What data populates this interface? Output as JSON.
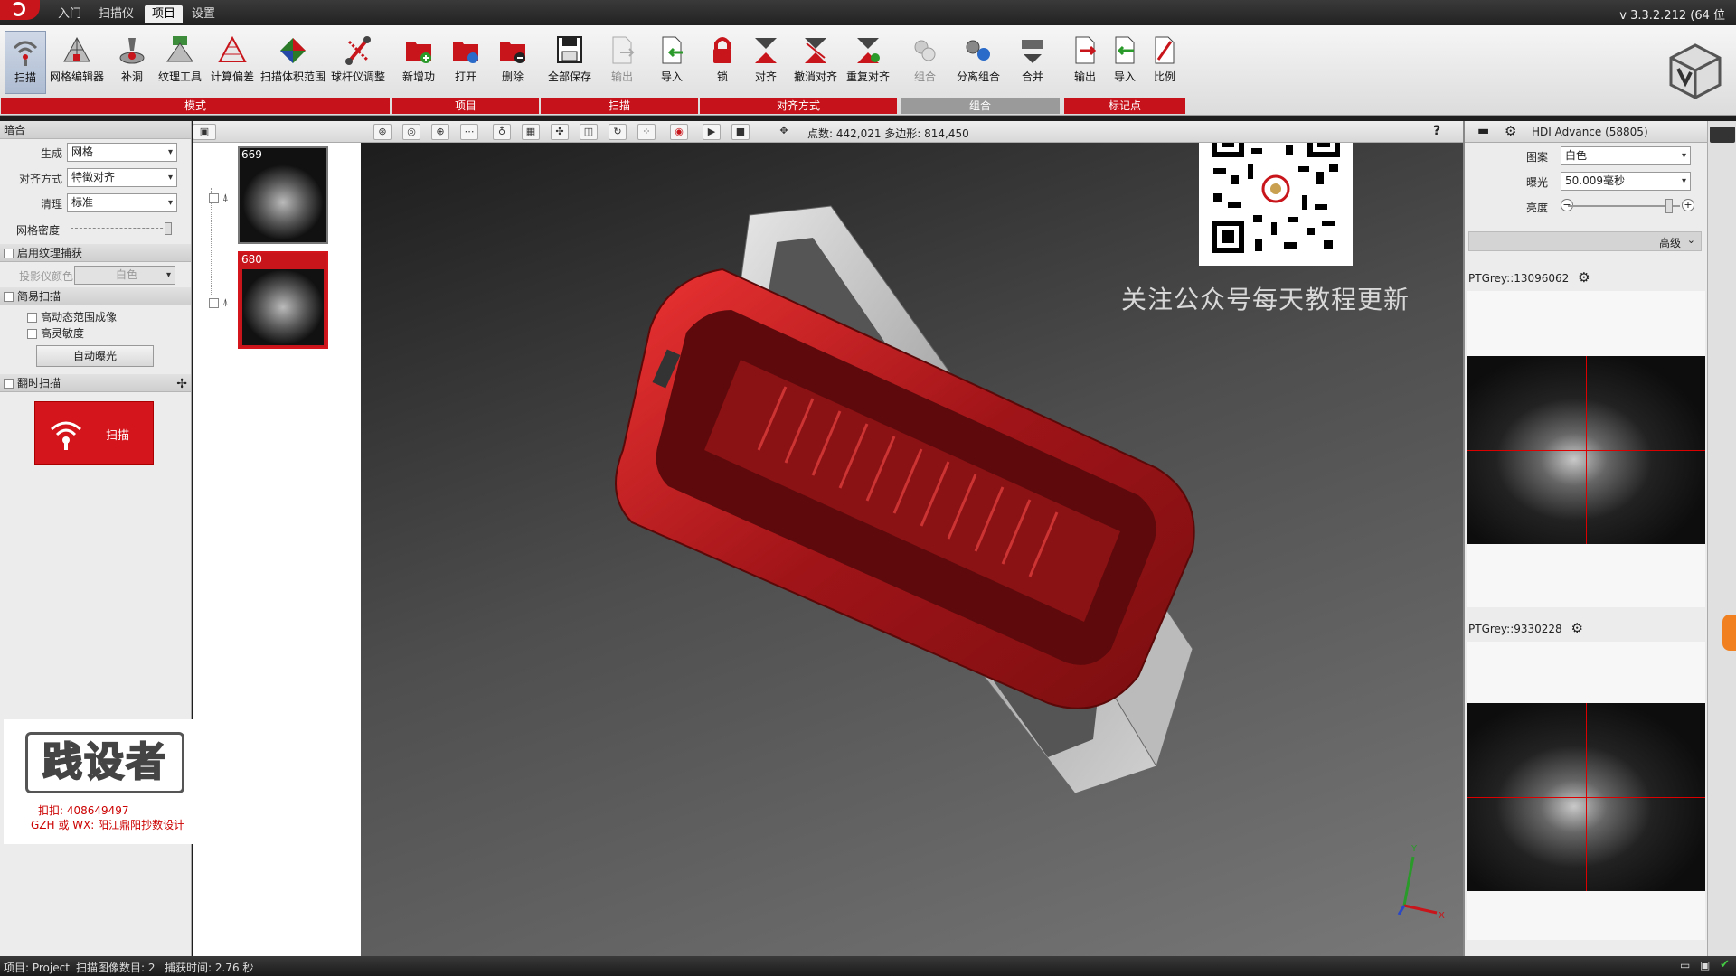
{
  "menubar": {
    "items": [
      "入门",
      "扫描仪",
      "项目",
      "设置"
    ],
    "active": "项目",
    "version": "v 3.3.2.212 (64 位"
  },
  "ribbon": {
    "groups": [
      {
        "label": "模式",
        "buttons": [
          "扫描",
          "网格编辑器",
          "补洞",
          "纹理工具",
          "计算偏差",
          "扫描体积范围",
          "球杆仪调整"
        ]
      },
      {
        "label": "项目",
        "buttons": [
          "新增功",
          "打开",
          "删除"
        ]
      },
      {
        "label": "扫描",
        "buttons": [
          "全部保存",
          "输出",
          "导入"
        ]
      },
      {
        "label": "对齐方式",
        "buttons": [
          "锁",
          "对齐",
          "撤消对齐",
          "重复对齐"
        ]
      },
      {
        "label": "组合",
        "buttons": [
          "组合",
          "分离组合",
          "合并"
        ]
      },
      {
        "label": "标记点",
        "buttons": [
          "输出",
          "导入",
          "比例"
        ]
      }
    ]
  },
  "left_panel": {
    "section_title": "暗合",
    "generate_label": "生成",
    "generate_value": "网格",
    "align_label": "对齐方式",
    "align_value": "特徵对齐",
    "clean_label": "清理",
    "clean_value": "标准",
    "mesh_density_label": "网格密度",
    "texture_capture_label": "启用纹理捕获",
    "projector_color_label": "投影仪颜色",
    "projector_color_value": "白色",
    "simple_scan_label": "简易扫描",
    "hdr_label": "高动态范围成像",
    "high_sensitivity_label": "高灵敏度",
    "auto_exposure_label": "自动曝光",
    "realtime_scan_label": "翻时扫描",
    "scan_button_label": "扫描"
  },
  "watermark": {
    "logo_text": "践设者",
    "qq_text": "扣扣: 408649497",
    "gzh_text": "GZH 或 WX: 阳江鼎阳抄数设计"
  },
  "thumbnails": [
    {
      "id": "669",
      "selected": false
    },
    {
      "id": "680",
      "selected": true
    }
  ],
  "viewport": {
    "stats": "点数: 442,021 多边形: 814,450",
    "help": "?",
    "promo_text": "关注公众号每天教程更新",
    "axis_x": "X",
    "axis_y": "Y"
  },
  "right_panel": {
    "device_title": "HDI Advance (58805)",
    "pattern_label": "图案",
    "pattern_value": "白色",
    "exposure_label": "曝光",
    "exposure_value": "50.009毫秒",
    "brightness_label": "亮度",
    "brightness_level": 0.9,
    "advanced_label": "高级",
    "camera1": "PTGrey::13096062",
    "camera2": "PTGrey::9330228"
  },
  "statusbar": {
    "project": "项目: Project",
    "scan_count": "扫描图像数目: 2",
    "capture_time": "捕获时间: 2.76 秒"
  },
  "colors": {
    "accent_red": "#c8151b",
    "mesh_red": "#b71c1c",
    "mesh_grey": "#bdbdbd"
  }
}
